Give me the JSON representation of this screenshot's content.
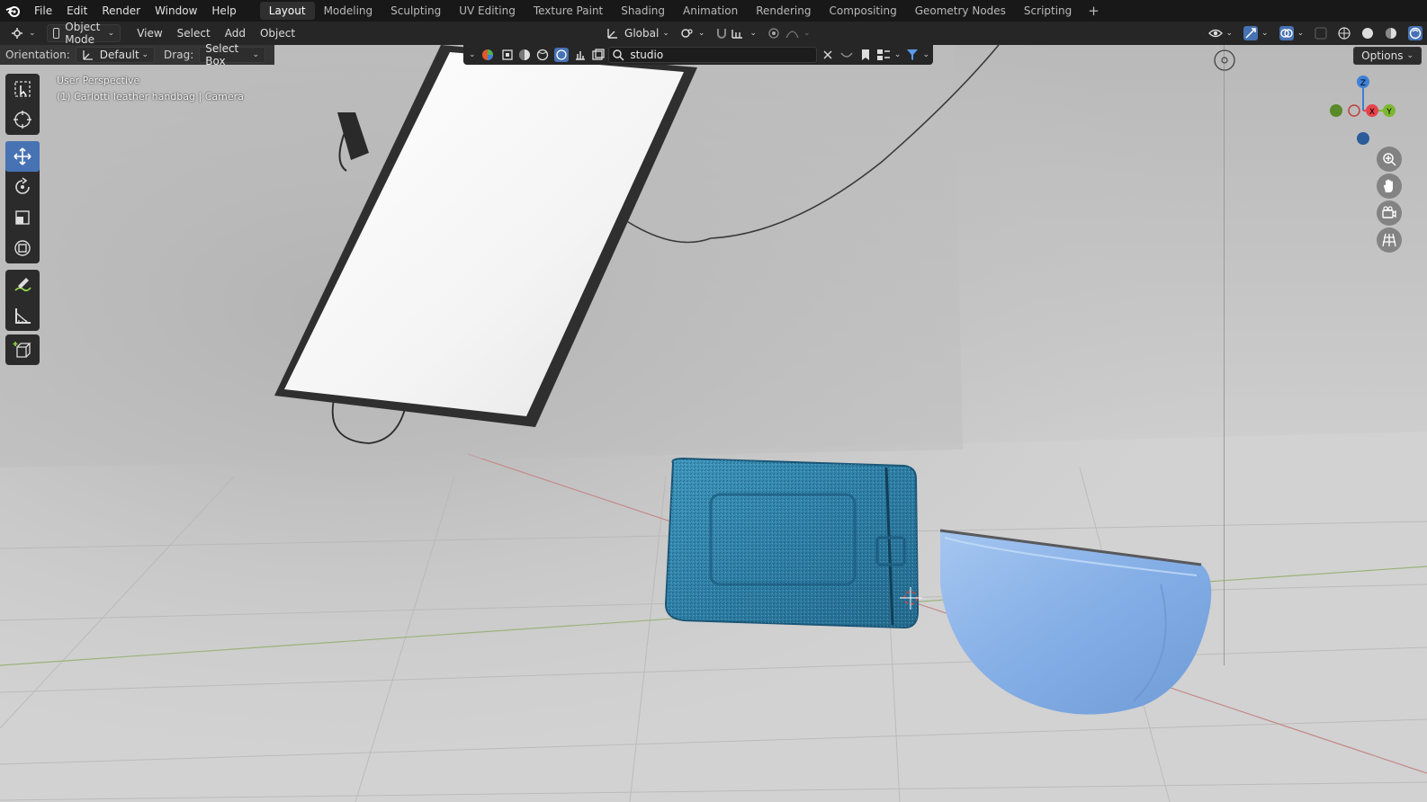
{
  "menu": {
    "items": [
      "File",
      "Edit",
      "Render",
      "Window",
      "Help"
    ]
  },
  "workspaces": {
    "tabs": [
      "Layout",
      "Modeling",
      "Sculpting",
      "UV Editing",
      "Texture Paint",
      "Shading",
      "Animation",
      "Rendering",
      "Compositing",
      "Geometry Nodes",
      "Scripting"
    ],
    "active": "Layout"
  },
  "header": {
    "mode": "Object Mode",
    "menus": [
      "View",
      "Select",
      "Add",
      "Object"
    ],
    "transform_orientation": "Global"
  },
  "tool_settings": {
    "orientation_label": "Orientation:",
    "orientation_value": "Default",
    "drag_label": "Drag:",
    "drag_value": "Select Box"
  },
  "filter": {
    "search_value": "studio"
  },
  "options_label": "Options",
  "viewport": {
    "perspective": "User Perspective",
    "active_object": "(1) Carlotti leather handbag | Camera"
  },
  "gizmo": {
    "axes": [
      "Z",
      "X",
      "Y"
    ]
  },
  "colors": {
    "accent": "#4772b3",
    "x_axis": "#e8424c",
    "y_axis": "#7cb82f",
    "z_axis": "#3f80d8",
    "bag": "#84aee6",
    "glass_bag": "#2e7fa6"
  }
}
